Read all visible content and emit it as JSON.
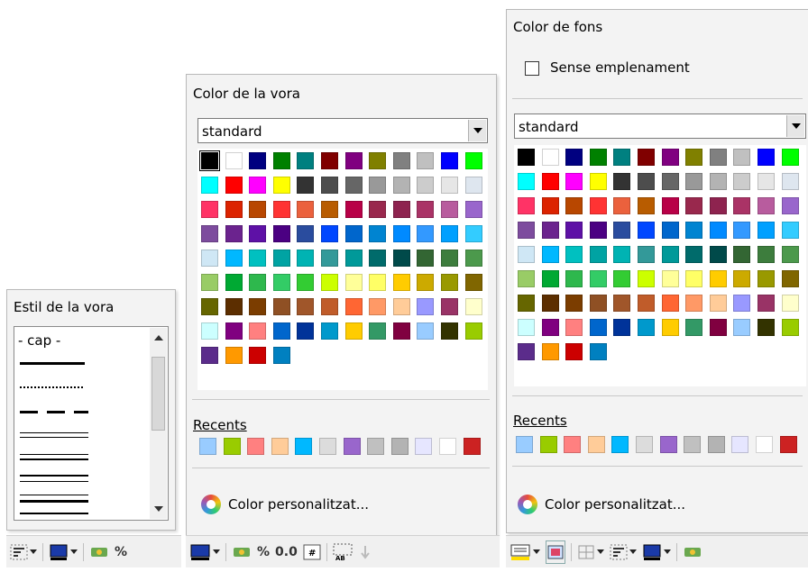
{
  "border_style_panel": {
    "title": "Estil de la vora",
    "items": [
      "- cap -"
    ]
  },
  "border_color_panel": {
    "title": "Color de la vora",
    "palette_select": "standard",
    "recents_label": "Recents",
    "custom_label": "Color personalitzat..."
  },
  "bg_color_panel": {
    "title": "Color de fons",
    "no_fill_label": "Sense emplenament",
    "palette_select": "standard",
    "recents_label": "Recents",
    "custom_label": "Color personalitzat..."
  },
  "toolbar": {
    "percent": "%",
    "decimal": "0.0"
  },
  "palette_colors": [
    "#000000",
    "#ffffff",
    "#000080",
    "#008000",
    "#008080",
    "#800000",
    "#800080",
    "#808000",
    "#808080",
    "#c0c0c0",
    "#0000ff",
    "#00ff00",
    "#00ffff",
    "#ff0000",
    "#ff00ff",
    "#ffff00",
    "#333333",
    "#4d4d4d",
    "#666666",
    "#999999",
    "#b3b3b3",
    "#cccccc",
    "#e6e6e6",
    "#dee6ef",
    "#ff3366",
    "#dc2300",
    "#b84700",
    "#ff3333",
    "#eb613d",
    "#b85c00",
    "#b80047",
    "#99284d",
    "#8e234f",
    "#aa3366",
    "#b85c9e",
    "#9966cc",
    "#7d4c9e",
    "#6b238e",
    "#5e11a6",
    "#4b0082",
    "#2a4c9e",
    "#0047ff",
    "#0066cc",
    "#0084d1",
    "#008aff",
    "#3399ff",
    "#00a0ff",
    "#33ccff",
    "#cfe7f5",
    "#00b8ff",
    "#00c0c0",
    "#00a3a3",
    "#00b3b3",
    "#339999",
    "#009999",
    "#006b6b",
    "#004a4a",
    "#336633",
    "#3d7d3d",
    "#4c994c",
    "#99cc66",
    "#00a933",
    "#2eb84d",
    "#33cc66",
    "#33cc33",
    "#ccff00",
    "#ffff99",
    "#ffff66",
    "#ffcc00",
    "#ccaa00",
    "#999900",
    "#806600",
    "#666600",
    "#5c2e00",
    "#7b3d00",
    "#8f5024",
    "#a0562a",
    "#c05c2a",
    "#ff6633",
    "#ff9966",
    "#ffcc99",
    "#9999ff",
    "#993366",
    "#ffffcc",
    "#ccffff",
    "#800080",
    "#ff8080",
    "#0066cc",
    "#003399",
    "#0099cc",
    "#ffcc00",
    "#339966",
    "#800040",
    "#99ccff",
    "#333300",
    "#99cc00",
    "#5b2c8b",
    "#ff9900",
    "#cc0000",
    "#0080c0"
  ],
  "recent_colors": [
    "#99ccff",
    "#99cc00",
    "#ff8080",
    "#ffcc99",
    "#00b8ff",
    "#dcdcdc",
    "#9966cc",
    "#c0c0c0",
    "#b3b3b3",
    "#e6e6ff",
    "#ffffff",
    "#cc2222"
  ]
}
